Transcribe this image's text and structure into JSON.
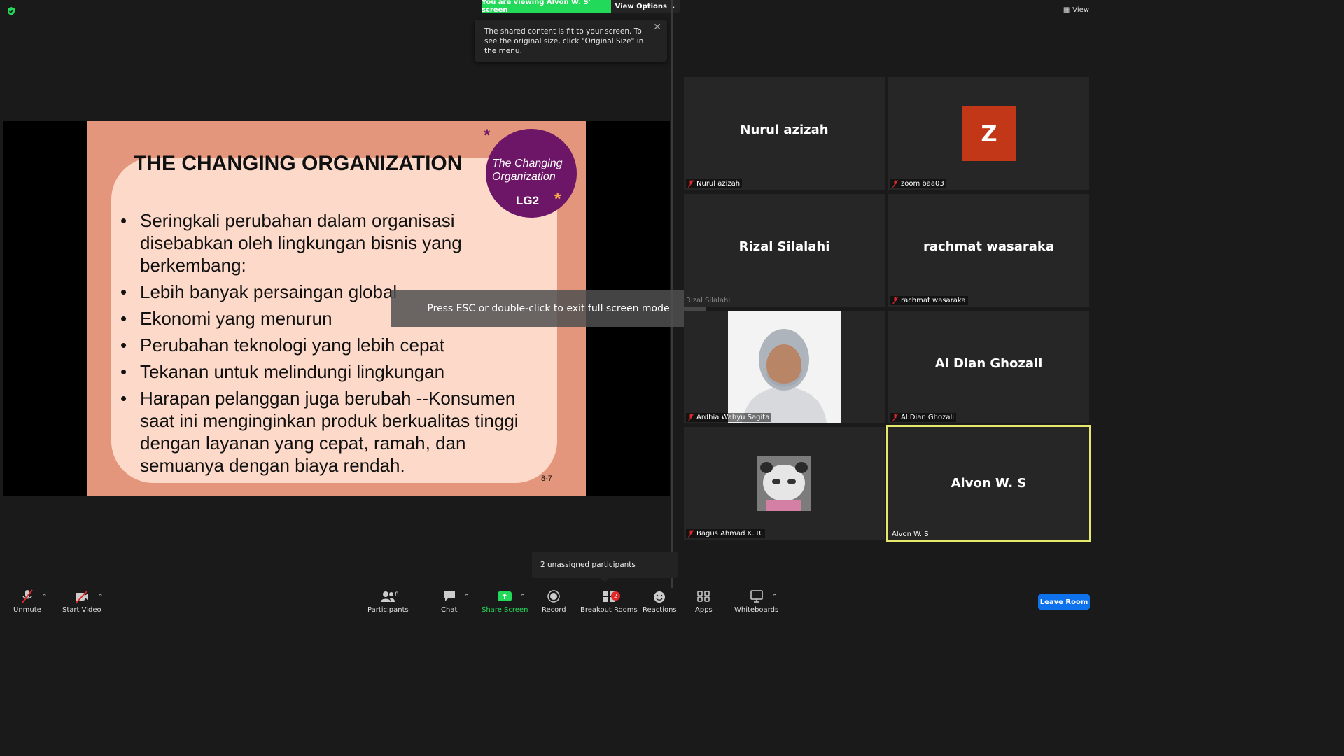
{
  "banner": {
    "viewing": "You are viewing Alvon W. S' screen",
    "view_options": "View Options",
    "view": "View"
  },
  "tooltip": {
    "text": "The shared content is fit to your screen. To see the original size, click \"Original Size\" in the menu."
  },
  "slide": {
    "title": "THE CHANGING ORGANIZATION",
    "circle_text": "The Changing Organization",
    "circle_code": "LG2",
    "bullets": [
      "Seringkali perubahan dalam organisasi disebabkan oleh lingkungan bisnis yang berkembang:",
      "Lebih banyak persaingan global",
      "Ekonomi yang menurun",
      "Perubahan teknologi yang lebih cepat",
      "Tekanan untuk melindungi lingkungan",
      "Harapan pelanggan juga berubah --Konsumen saat ini menginginkan produk berkualitas tinggi dengan layanan yang cepat, ramah, dan semuanya dengan biaya rendah."
    ],
    "number": "8-7"
  },
  "esc_message": "Press ESC or double-click to exit full screen mode",
  "participants": [
    {
      "display": "Nurul azizah",
      "label": "Nurul azizah"
    },
    {
      "display": "Z",
      "label": "zoom baa03"
    },
    {
      "display": "Rizal Silalahi",
      "label": "Rizal Silalahi"
    },
    {
      "display": "rachmat wasaraka",
      "label": "rachmat wasaraka"
    },
    {
      "display": "",
      "label": "Ardhia Wahyu Sagita"
    },
    {
      "display": "Al Dian Ghozali",
      "label": "Al Dian Ghozali"
    },
    {
      "display": "",
      "label": "Bagus Ahmad K. R."
    },
    {
      "display": "Alvon W. S",
      "label": "Alvon W. S"
    }
  ],
  "unassigned": "2 unassigned participants",
  "toolbar": {
    "unmute": "Unmute",
    "start_video": "Start Video",
    "participants": "Participants",
    "participants_count": "8",
    "chat": "Chat",
    "share_screen": "Share Screen",
    "record": "Record",
    "breakout_rooms": "Breakout Rooms",
    "breakout_count": "2",
    "reactions": "Reactions",
    "apps": "Apps",
    "whiteboards": "Whiteboards",
    "leave": "Leave Room"
  },
  "colors": {
    "accent_green": "#23d959",
    "leave_blue": "#0e72ed",
    "active_speaker": "#e5e86b",
    "slide_bg": "#e3967c",
    "slide_card": "#fdd9c9",
    "slide_circle": "#6d1566",
    "avatar_z": "#c23717"
  }
}
